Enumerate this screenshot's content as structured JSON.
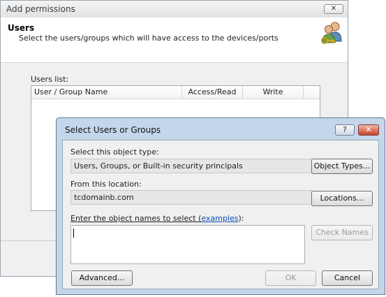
{
  "back_window": {
    "title": "Add permissions",
    "close_glyph": "✕",
    "header_title": "Users",
    "header_subtitle": "Select the users/groups which will have access  to the devices/ports",
    "users_icon": "users-key-icon",
    "users_list_label": "Users list:",
    "columns": [
      "User / Group Name",
      "Access/Read",
      "Write"
    ]
  },
  "dialog": {
    "title": "Select Users or Groups",
    "help_glyph": "?",
    "close_glyph": "✕",
    "object_type_label": "Select this object type:",
    "object_type_value": "Users, Groups, or Built-in security principals",
    "object_types_button": "Object Types...",
    "location_label": "From this location:",
    "location_value": "tcdomainb.com",
    "locations_button": "Locations...",
    "names_label_prefix": "Enter the object names to select (",
    "names_label_link": "examples",
    "names_label_suffix": "):",
    "names_value": "",
    "check_names_button": "Check Names",
    "advanced_button": "Advanced...",
    "ok_button": "OK",
    "cancel_button": "Cancel"
  },
  "colors": {
    "dialog_frame": "#c3d6ea",
    "close_button": "#c8422a",
    "link": "#0b4fb3"
  }
}
